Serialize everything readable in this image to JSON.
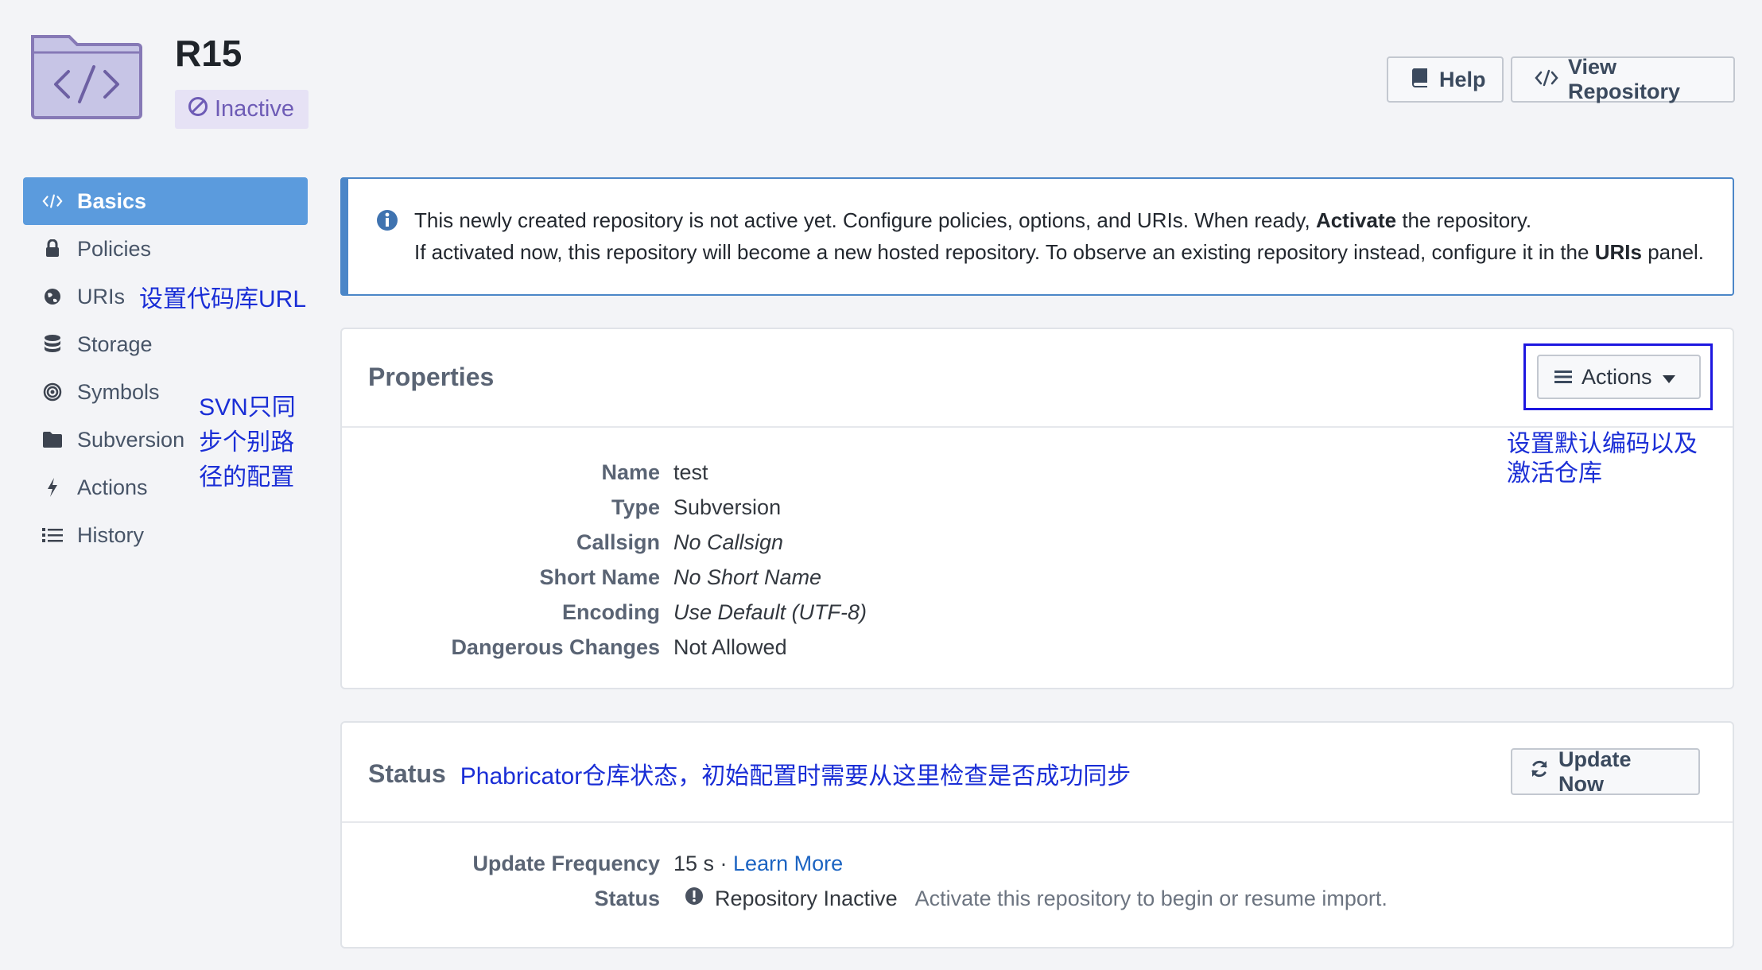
{
  "header": {
    "repo_name": "R15",
    "status_badge": "Inactive",
    "help_label": "Help",
    "view_repo_label": "View Repository",
    "icon": "folder-code-icon"
  },
  "sidebar": {
    "items": [
      {
        "label": "Basics",
        "icon": "code-icon",
        "active": true
      },
      {
        "label": "Policies",
        "icon": "lock-icon"
      },
      {
        "label": "URIs",
        "icon": "globe-icon",
        "annotation": "设置代码库URL"
      },
      {
        "label": "Storage",
        "icon": "database-icon"
      },
      {
        "label": "Symbols",
        "icon": "bullseye-icon"
      },
      {
        "label": "Subversion",
        "icon": "folder-icon",
        "annotation": "SVN只同步个别路径的配置"
      },
      {
        "label": "Actions",
        "icon": "bolt-icon"
      },
      {
        "label": "History",
        "icon": "list-icon"
      }
    ]
  },
  "notice": {
    "line1_pre": "This newly created repository is not active yet. Configure policies, options, and URIs. When ready, ",
    "line1_bold": "Activate",
    "line1_post": " the repository.",
    "line2_pre": "If activated now, this repository will become a new hosted repository. To observe an existing repository instead, configure it in the ",
    "line2_bold": "URIs",
    "line2_post": " panel."
  },
  "properties": {
    "title": "Properties",
    "actions_label": "Actions",
    "actions_annotation_line1": "设置默认编码以及",
    "actions_annotation_line2": "激活仓库",
    "rows": [
      {
        "label": "Name",
        "value": "test"
      },
      {
        "label": "Type",
        "value": "Subversion"
      },
      {
        "label": "Callsign",
        "value": "No Callsign"
      },
      {
        "label": "Short Name",
        "value": "No Short Name"
      },
      {
        "label": "Encoding",
        "value": "Use Default (UTF-8)"
      },
      {
        "label": "Dangerous Changes",
        "value": "Not Allowed"
      }
    ]
  },
  "status": {
    "title": "Status",
    "annotation": "Phabricator仓库状态，初始配置时需要从这里检查是否成功同步",
    "update_label": "Update Now",
    "frequency_label": "Update Frequency",
    "frequency_value": "15 s · ",
    "learn_more": "Learn More",
    "status_label": "Status",
    "status_value": "Repository Inactive",
    "status_hint": "Activate this repository to begin or resume import."
  }
}
